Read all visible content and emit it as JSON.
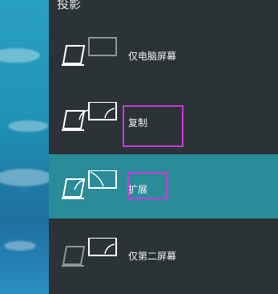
{
  "panel": {
    "title": "投影",
    "options": [
      {
        "label": "仅电脑屏幕",
        "icon": "pc-screen-only-icon",
        "selected": false
      },
      {
        "label": "复制",
        "icon": "duplicate-icon",
        "selected": false
      },
      {
        "label": "扩展",
        "icon": "extend-icon",
        "selected": true
      },
      {
        "label": "仅第二屏幕",
        "icon": "second-screen-only-icon",
        "selected": false
      }
    ]
  },
  "colors": {
    "panel_bg": "#2b3337",
    "selected_bg": "#2a8c99",
    "highlight": "#c63bdc"
  }
}
